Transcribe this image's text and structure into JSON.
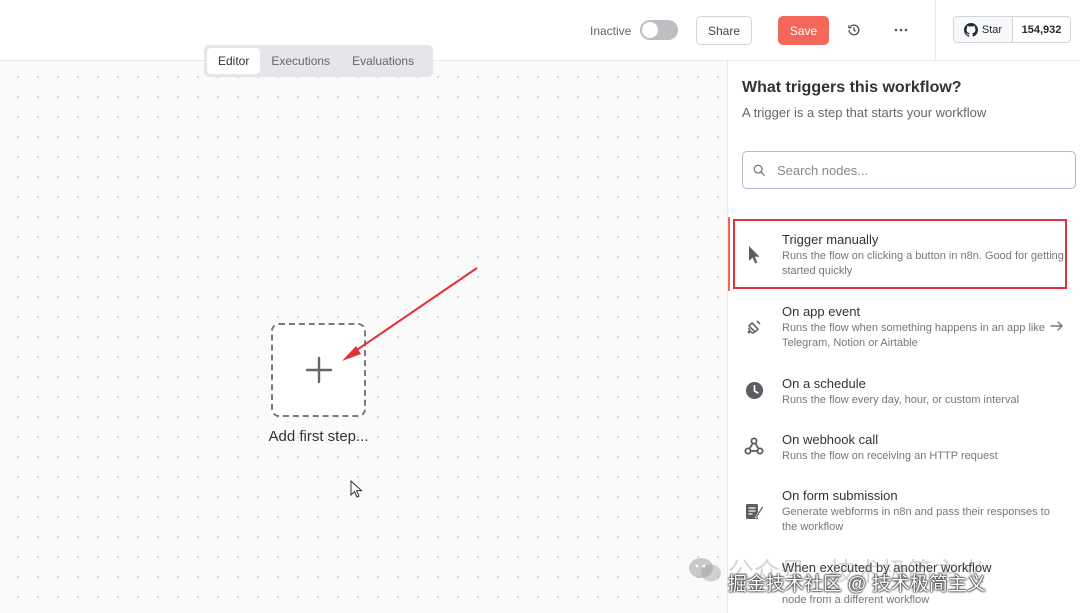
{
  "topbar": {
    "status_label": "Inactive",
    "share_label": "Share",
    "save_label": "Save",
    "github": {
      "star_label": "Star",
      "star_count": "154,932"
    }
  },
  "canvas": {
    "tabs": [
      {
        "label": "Editor",
        "active": true
      },
      {
        "label": "Executions",
        "active": false
      },
      {
        "label": "Evaluations",
        "active": false
      }
    ],
    "add_step_label": "Add first step..."
  },
  "panel": {
    "title": "What triggers this workflow?",
    "subtitle": "A trigger is a step that starts your workflow",
    "search_placeholder": "Search nodes...",
    "items": [
      {
        "title": "Trigger manually",
        "desc": "Runs the flow on clicking a button in n8n. Good for getting started quickly",
        "icon": "cursor-icon"
      },
      {
        "title": "On app event",
        "desc": "Runs the flow when something happens in an app like Telegram, Notion or Airtable",
        "icon": "satellite-icon"
      },
      {
        "title": "On a schedule",
        "desc": "Runs the flow every day, hour, or custom interval",
        "icon": "clock-icon"
      },
      {
        "title": "On webhook call",
        "desc": "Runs the flow on receiving an HTTP request",
        "icon": "webhook-icon"
      },
      {
        "title": "On form submission",
        "desc": "Generate webforms in n8n and pass their responses to the workflow",
        "icon": "form-icon"
      },
      {
        "title": "When executed by another workflow",
        "desc": "node from a different workflow",
        "icon": "workflow-icon"
      }
    ]
  },
  "watermark": {
    "bg_text": "公众号 · 技术极简主义",
    "fg_text": "掘金技术社区 @ 技术极简主义"
  },
  "colors": {
    "accent": "#f2675a",
    "highlight_box": "#e0323a"
  }
}
